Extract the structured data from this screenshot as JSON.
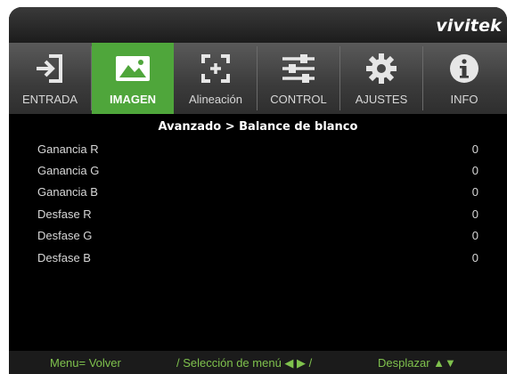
{
  "brand": "vivitek",
  "colors": {
    "accent": "#4fa63b",
    "footer_text": "#7fc24d",
    "panel": "#000000"
  },
  "tabs": [
    {
      "label": "ENTRADA",
      "icon": "input-arrow-icon",
      "active": false
    },
    {
      "label": "IMAGEN",
      "icon": "image-icon",
      "active": true
    },
    {
      "label": "Alineación",
      "icon": "alignment-icon",
      "active": false
    },
    {
      "label": "CONTROL",
      "icon": "sliders-icon",
      "active": false
    },
    {
      "label": "AJUSTES",
      "icon": "gear-icon",
      "active": false
    },
    {
      "label": "INFO",
      "icon": "info-icon",
      "active": false
    }
  ],
  "breadcrumb": "Avanzado > Balance de blanco",
  "settings": [
    {
      "label": "Ganancia R",
      "value": "0"
    },
    {
      "label": "Ganancia G",
      "value": "0"
    },
    {
      "label": "Ganancia B",
      "value": "0"
    },
    {
      "label": "Desfase R",
      "value": "0"
    },
    {
      "label": "Desfase G",
      "value": "0"
    },
    {
      "label": "Desfase B",
      "value": "0"
    }
  ],
  "footer": {
    "menu": "Menu= Volver",
    "select": "/ Selección de menú ◀ ▶ /",
    "scroll": "Desplazar ▲▼"
  }
}
